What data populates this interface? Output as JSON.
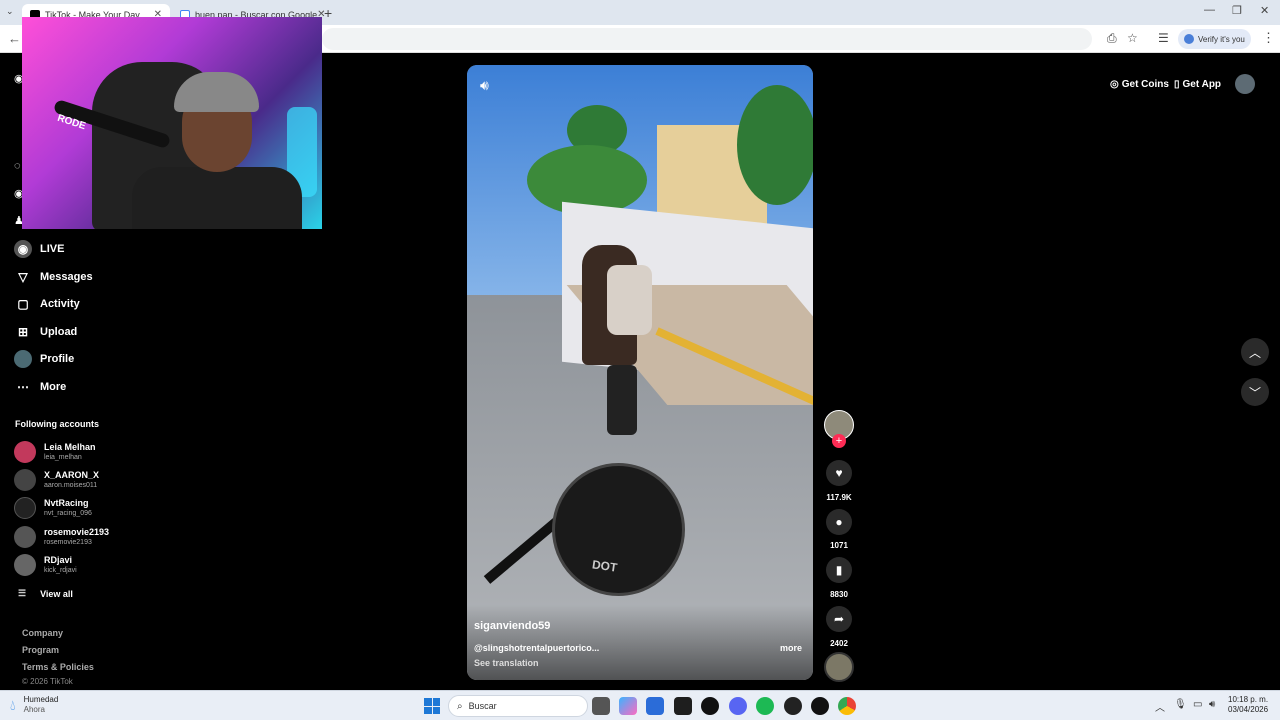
{
  "browser": {
    "tabs": [
      {
        "title": "TikTok - Make Your Day",
        "active": true
      },
      {
        "title": "buen pan - Buscar con Google",
        "active": false
      }
    ],
    "verify_label": "Verify it's you"
  },
  "sidebar": {
    "nav": [
      {
        "label": "LIVE",
        "icon": "live-icon"
      },
      {
        "label": "Messages",
        "icon": "messages-icon"
      },
      {
        "label": "Activity",
        "icon": "activity-icon"
      },
      {
        "label": "Upload",
        "icon": "upload-icon"
      },
      {
        "label": "Profile",
        "icon": "profile-icon"
      },
      {
        "label": "More",
        "icon": "more-icon"
      }
    ],
    "following_title": "Following accounts",
    "following": [
      {
        "name": "Leia Melhan",
        "handle": "leia_melhan",
        "color": "#c2395c"
      },
      {
        "name": "X_AARON_X",
        "handle": "aaron.moises011",
        "color": "#444444"
      },
      {
        "name": "NvtRacing",
        "handle": "nvt_racing_096",
        "color": "#222222"
      },
      {
        "name": "rosemovie2193",
        "handle": "rosemovie2193",
        "color": "#555555"
      },
      {
        "name": "RDjavi",
        "handle": "kick_rdjavi",
        "color": "#666666"
      }
    ],
    "view_all": "View all",
    "footer": [
      "Company",
      "Program",
      "Terms & Policies"
    ],
    "copyright": "© 2026 TikTok"
  },
  "topbar": {
    "get_coins": "Get Coins",
    "get_app": "Get App"
  },
  "video": {
    "author": "siganviendo59",
    "caption": "@slingshotrentalpuertorico...",
    "more": "more",
    "see_translation": "See translation",
    "mirror_text": "DOT"
  },
  "actions": {
    "likes": "117.9K",
    "comments": "1071",
    "saves": "8830",
    "shares": "2402"
  },
  "taskbar": {
    "weather_title": "Humedad",
    "weather_sub": "Ahora",
    "search_placeholder": "Buscar",
    "time": "10:18 p. m.",
    "date": "03/04/2026"
  },
  "webcam": {
    "mic_label": "RODE"
  },
  "colors": {
    "accent": "#fe2c55",
    "background": "#000000"
  }
}
